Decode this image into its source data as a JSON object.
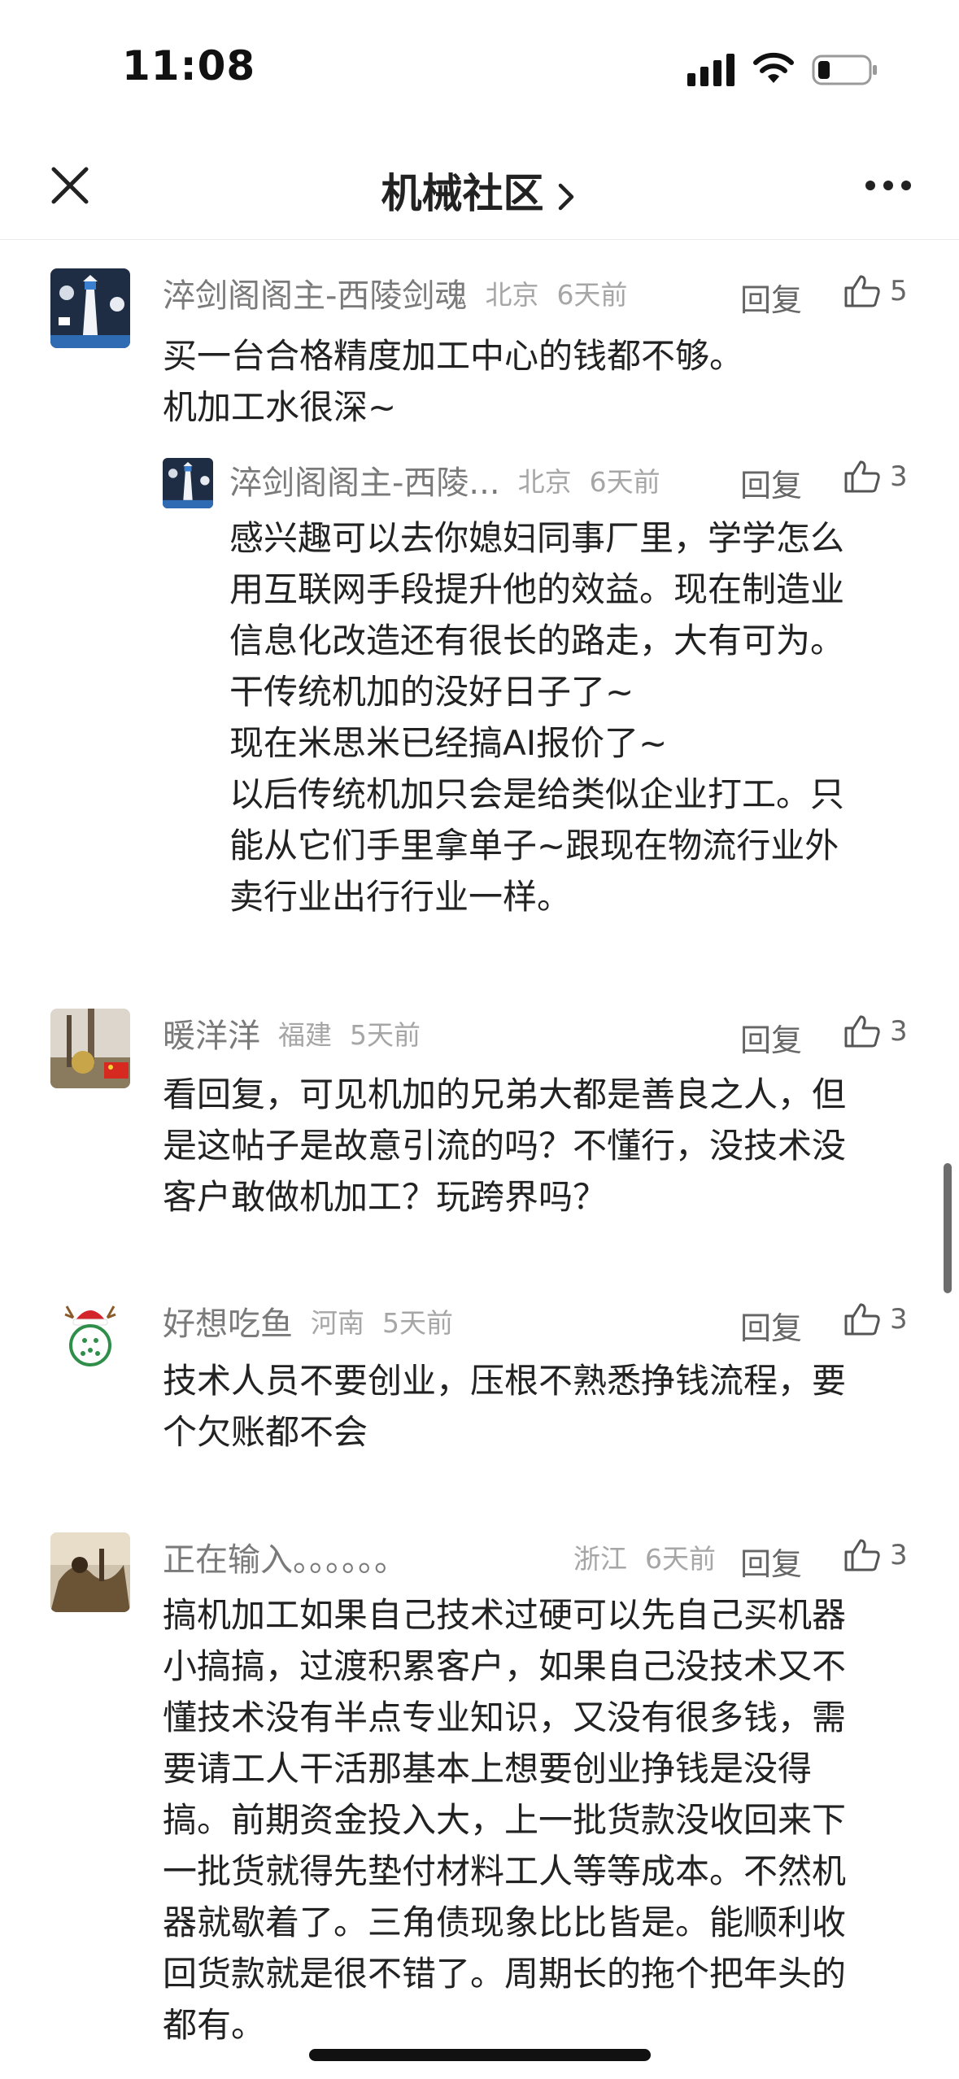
{
  "status_bar": {
    "time": "11:08",
    "icons": [
      "cellular-signal-icon",
      "wifi-icon",
      "battery-icon"
    ]
  },
  "nav": {
    "title": "机械社区",
    "icons": [
      "close-icon",
      "chevron-right-icon",
      "more-icon"
    ]
  },
  "comments": [
    {
      "username": "淬剑阁阁主-西陵剑魂",
      "location": "北京",
      "time": "6天前",
      "reply": "回复",
      "likes": "5",
      "text": "买一台合格精度加工中心的钱都不够。\n机加工水很深~",
      "sub_reply": {
        "username": "淬剑阁阁主-西陵...",
        "location": "北京",
        "time": "6天前",
        "reply": "回复",
        "likes": "3",
        "text": "感兴趣可以去你媳妇同事厂里，学学怎么\n用互联网手段提升他的效益。现在制造业\n信息化改造还有很长的路走，大有可为。\n干传统机加的没好日子了~\n现在米思米已经搞AI报价了~\n以后传统机加只会是给类似企业打工。只\n能从它们手里拿单子~跟现在物流行业外\n卖行业出行行业一样。"
      }
    },
    {
      "username": "暖洋洋",
      "location": "福建",
      "time": "5天前",
      "reply": "回复",
      "likes": "3",
      "text": "看回复，可见机加的兄弟大都是善良之人，但\n是这帖子是故意引流的吗？不懂行，没技术没\n客户敢做机加工？玩跨界吗？"
    },
    {
      "username": "好想吃鱼",
      "location": "河南",
      "time": "5天前",
      "reply": "回复",
      "likes": "3",
      "text": "技术人员不要创业，压根不熟悉挣钱流程，要\n个欠账都不会"
    },
    {
      "username": "正在输入。。。。。。",
      "location": "浙江",
      "time": "6天前",
      "reply": "回复",
      "likes": "3",
      "text": "搞机加工如果自己技术过硬可以先自己买机器\n小搞搞，过渡积累客户，如果自己没技术又不\n懂技术没有半点专业知识，又没有很多钱，需\n要请工人干活那基本上想要创业挣钱是没得\n搞。前期资金投入大，上一批货款没收回来下\n一批货就得先垫付材料工人等等成本。不然机\n器就歇着了。三角债现象比比皆是。能顺利收\n回货款就是很不错了。周期长的拖个把年头的\n都有。"
    }
  ]
}
